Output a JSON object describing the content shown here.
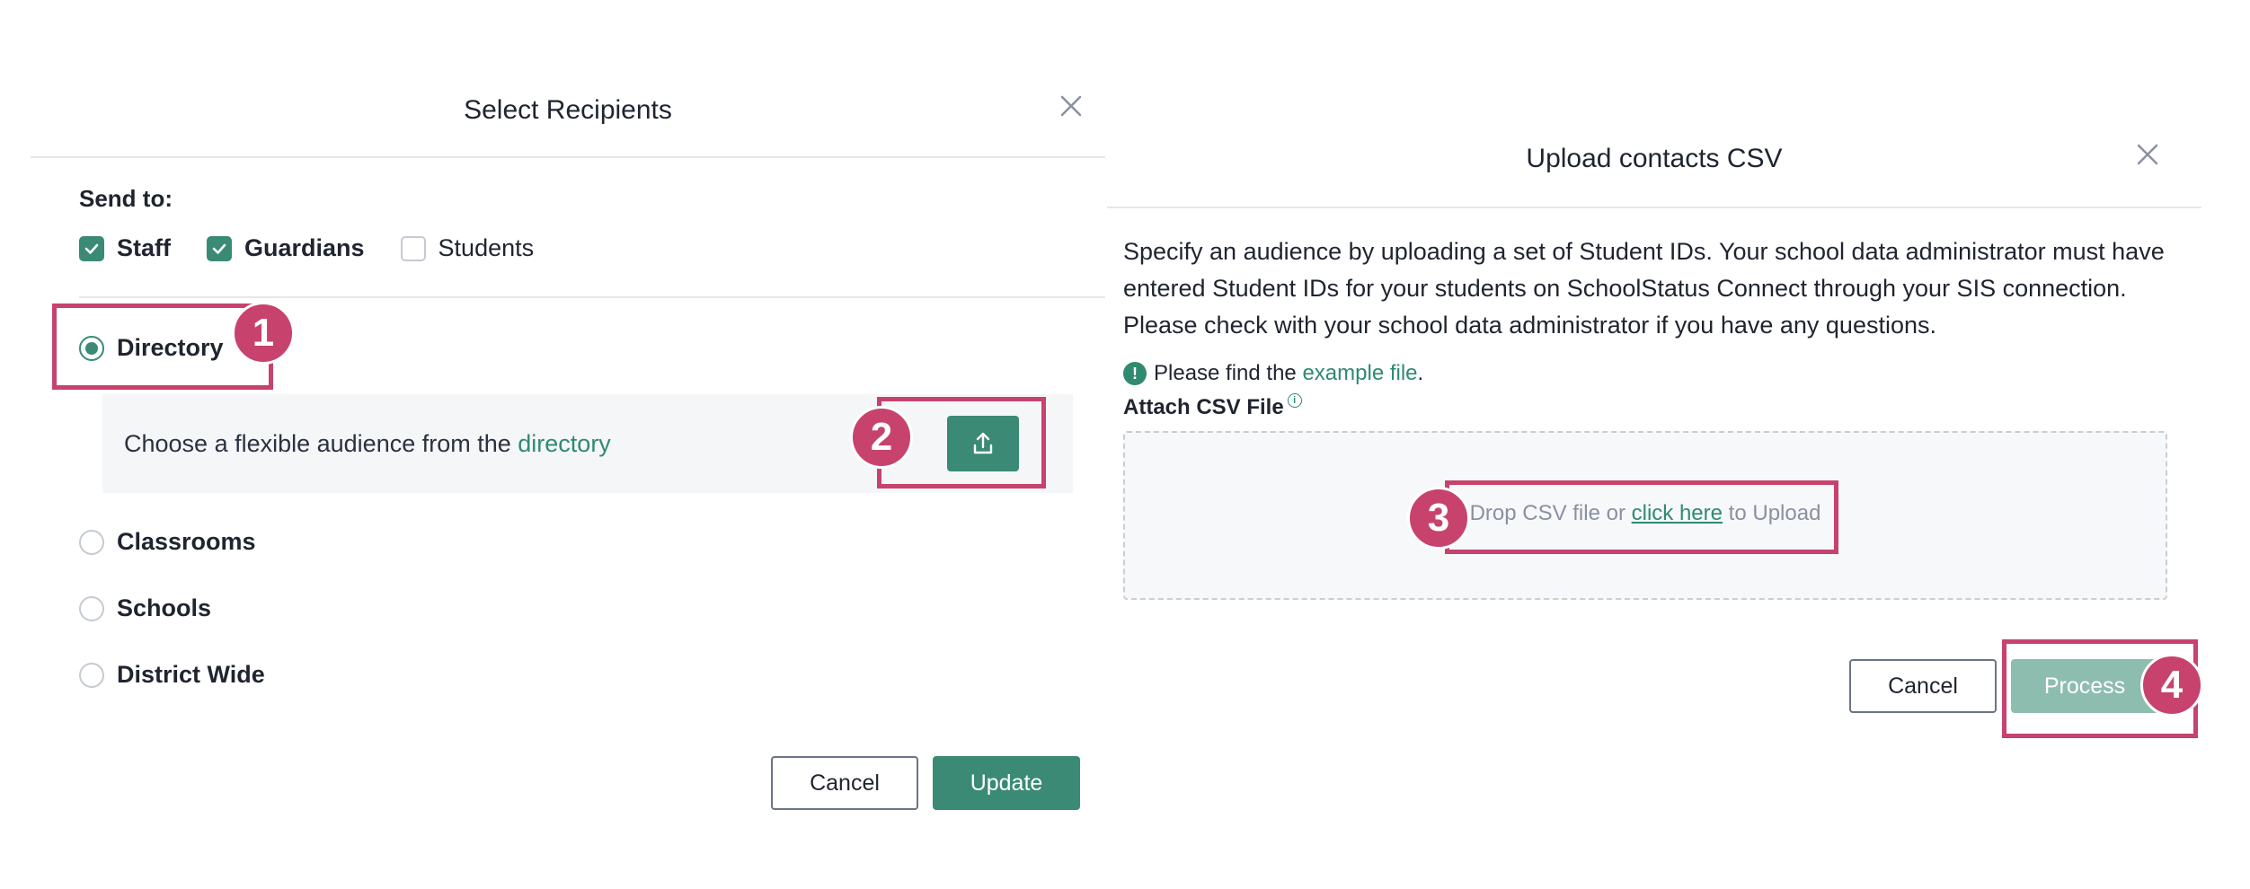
{
  "left_modal": {
    "title": "Select Recipients",
    "send_to_label": "Send to:",
    "checkboxes": [
      {
        "label": "Staff",
        "checked": true
      },
      {
        "label": "Guardians",
        "checked": true
      },
      {
        "label": "Students",
        "checked": false
      }
    ],
    "radios": [
      {
        "label": "Directory",
        "selected": true
      },
      {
        "label": "Classrooms",
        "selected": false
      },
      {
        "label": "Schools",
        "selected": false
      },
      {
        "label": "District Wide",
        "selected": false
      }
    ],
    "directory_text": "Choose a flexible audience from the",
    "directory_link": "directory",
    "cancel_label": "Cancel",
    "update_label": "Update"
  },
  "right_modal": {
    "title": "Upload contacts CSV",
    "description": "Specify an audience by uploading a set of Student IDs. Your school data administrator must have entered Student IDs for your students on SchoolStatus Connect through your SIS connection. Please check with your school data administrator if you have any questions.",
    "note_icon_glyph": "!",
    "note_prefix": "Please find the",
    "note_link": "example file",
    "note_suffix": ".",
    "attach_label": "Attach CSV File",
    "info_glyph": "i",
    "drop_prefix": "Drop CSV file or",
    "drop_link": "click here",
    "drop_suffix": "to Upload",
    "cancel_label": "Cancel",
    "process_label": "Process"
  },
  "badges": [
    "1",
    "2",
    "3",
    "4"
  ],
  "icons": {
    "close": "close-icon",
    "check": "check-icon",
    "upload": "upload-icon",
    "exclamation": "exclamation-icon",
    "info": "info-icon"
  },
  "colors": {
    "primary": "#3a8a75",
    "primary_disabled": "#8dbdaf",
    "link": "#2f8a70",
    "highlight": "#c7426d",
    "text": "#1f2430"
  }
}
